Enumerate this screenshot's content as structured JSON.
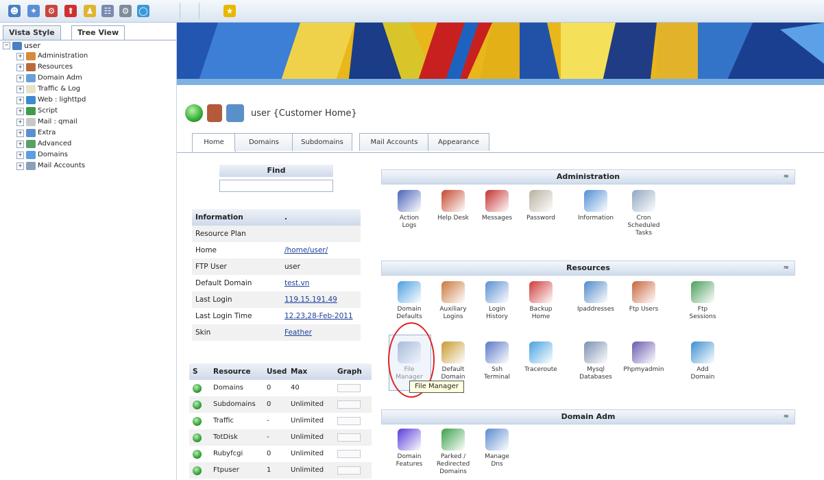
{
  "toolbar": {
    "icons": [
      {
        "name": "users-icon",
        "color": "#4a7fc4",
        "glyph": "☻"
      },
      {
        "name": "wand-icon",
        "color": "#5a8fd6",
        "glyph": "✦"
      },
      {
        "name": "tools-icon",
        "color": "#c8463c",
        "glyph": "⚙"
      },
      {
        "name": "arrow-up-icon",
        "color": "#d03030",
        "glyph": "⬆"
      },
      {
        "name": "person-icon",
        "color": "#e0b430",
        "glyph": "♟"
      },
      {
        "name": "chat-icon",
        "color": "#7a8ab0",
        "glyph": "☷"
      },
      {
        "name": "gear-icon",
        "color": "#7f8c99",
        "glyph": "⚙"
      },
      {
        "name": "bubble-icon",
        "color": "#3a9ad8",
        "glyph": "◯"
      },
      {
        "name": "favorites-icon",
        "color": "#e8b800",
        "glyph": "★"
      }
    ]
  },
  "left": {
    "tabs": [
      "Vista Style",
      "Tree View"
    ],
    "root_label": "user",
    "items": [
      {
        "label": "Administration",
        "color": "#d9893a"
      },
      {
        "label": "Resources",
        "color": "#b96a3c"
      },
      {
        "label": "Domain Adm",
        "color": "#6aa0d8"
      },
      {
        "label": "Traffic & Log",
        "color": "#e8e2c8"
      },
      {
        "label": "Web : lighttpd",
        "color": "#3c8ad0"
      },
      {
        "label": "Script",
        "color": "#3e9c48"
      },
      {
        "label": "Mail : qmail",
        "color": "#c8c8c8"
      },
      {
        "label": "Extra",
        "color": "#5a90d0"
      },
      {
        "label": "Advanced",
        "color": "#58a068"
      },
      {
        "label": "Domains",
        "color": "#5c9ee0"
      },
      {
        "label": "Mail Accounts",
        "color": "#8aa0b8"
      }
    ]
  },
  "header": {
    "title": "user {Customer Home}"
  },
  "tabs": [
    "Home",
    "Domains",
    "Subdomains",
    "Mail Accounts",
    "Appearance"
  ],
  "find": {
    "title": "Find",
    "value": ""
  },
  "info": {
    "head_key": "Information",
    "head_val": ".",
    "rows": [
      {
        "k": "Resource Plan",
        "v": "",
        "link": false
      },
      {
        "k": "Home",
        "v": "/home/user/",
        "link": true
      },
      {
        "k": "FTP User",
        "v": "user",
        "link": false
      },
      {
        "k": "Default Domain",
        "v": "test.vn",
        "link": true
      },
      {
        "k": "Last Login",
        "v": "119.15.191.49",
        "link": true
      },
      {
        "k": "Last Login Time",
        "v": "12.23,28-Feb-2011",
        "link": true
      },
      {
        "k": "Skin",
        "v": "Feather",
        "link": true
      }
    ]
  },
  "resources": {
    "headers": {
      "s": "S",
      "resource": "Resource",
      "used": "Used",
      "max": "Max",
      "graph": "Graph"
    },
    "rows": [
      {
        "name": "Domains",
        "used": "0",
        "max": "40"
      },
      {
        "name": "Subdomains",
        "used": "0",
        "max": "Unlimited"
      },
      {
        "name": "Traffic",
        "used": "-",
        "max": "Unlimited"
      },
      {
        "name": "TotDisk",
        "used": "-",
        "max": "Unlimited"
      },
      {
        "name": "Rubyfcgi",
        "used": "0",
        "max": "Unlimited"
      },
      {
        "name": "Ftpuser",
        "used": "1",
        "max": "Unlimited"
      }
    ]
  },
  "panels": {
    "administration": {
      "title": "Administration",
      "collapse": "≈",
      "items": [
        {
          "label": "Action\nLogs",
          "icon": "action-logs-icon",
          "color": "#4a62b8"
        },
        {
          "label": "Help Desk",
          "icon": "help-desk-icon",
          "color": "#c4462c"
        },
        {
          "label": "Messages",
          "icon": "messages-icon",
          "color": "#c43030"
        },
        {
          "label": "Password",
          "icon": "password-icon",
          "color": "#b8b0a0"
        },
        {
          "label": "Information",
          "icon": "information-icon",
          "color": "#4f8ed6"
        },
        {
          "label": "Cron\nScheduled\nTasks",
          "icon": "cron-icon",
          "color": "#8fa6c0"
        }
      ]
    },
    "resources": {
      "title": "Resources",
      "collapse": "≈",
      "items": [
        {
          "label": "Domain\nDefaults",
          "icon": "domain-defaults-icon",
          "color": "#4aa0e0"
        },
        {
          "label": "Auxiliary\nLogins",
          "icon": "auxiliary-logins-icon",
          "color": "#c8783a"
        },
        {
          "label": "Login\nHistory",
          "icon": "login-history-icon",
          "color": "#5a8ed0"
        },
        {
          "label": "Backup\nHome",
          "icon": "backup-home-icon",
          "color": "#d03a3a"
        },
        {
          "label": "Ipaddresses",
          "icon": "ipaddresses-icon",
          "color": "#4f8ac8"
        },
        {
          "label": "Ftp Users",
          "icon": "ftp-users-icon",
          "color": "#c8643a"
        },
        {
          "label": "Ftp\nSessions",
          "icon": "ftp-sessions-icon",
          "color": "#4a9e5a"
        },
        {
          "label": "File\nManager",
          "icon": "file-manager-icon",
          "color": "#6a8ab8"
        },
        {
          "label": "Default\nDomain",
          "icon": "default-domain-icon",
          "color": "#c89a30"
        },
        {
          "label": "Ssh\nTerminal",
          "icon": "ssh-terminal-icon",
          "color": "#5a78c8"
        },
        {
          "label": "Traceroute",
          "icon": "traceroute-icon",
          "color": "#48a2e0"
        },
        {
          "label": "Mysql\nDatabases",
          "icon": "mysql-icon",
          "color": "#7a90b0"
        },
        {
          "label": "Phpmyadmin",
          "icon": "phpmyadmin-icon",
          "color": "#6a58b0"
        },
        {
          "label": "Add\nDomain",
          "icon": "add-domain-icon",
          "color": "#3a90d0"
        }
      ]
    },
    "domainadm": {
      "title": "Domain Adm",
      "collapse": "≈",
      "items": [
        {
          "label": "Domain\nFeatures",
          "icon": "domain-features-icon",
          "color": "#5a3ad8"
        },
        {
          "label": "Parked /\nRedirected\nDomains",
          "icon": "parked-domains-icon",
          "color": "#3aa04a"
        },
        {
          "label": "Manage\nDns",
          "icon": "manage-dns-icon",
          "color": "#5a8ad0"
        }
      ]
    }
  },
  "tooltip": "File Manager"
}
